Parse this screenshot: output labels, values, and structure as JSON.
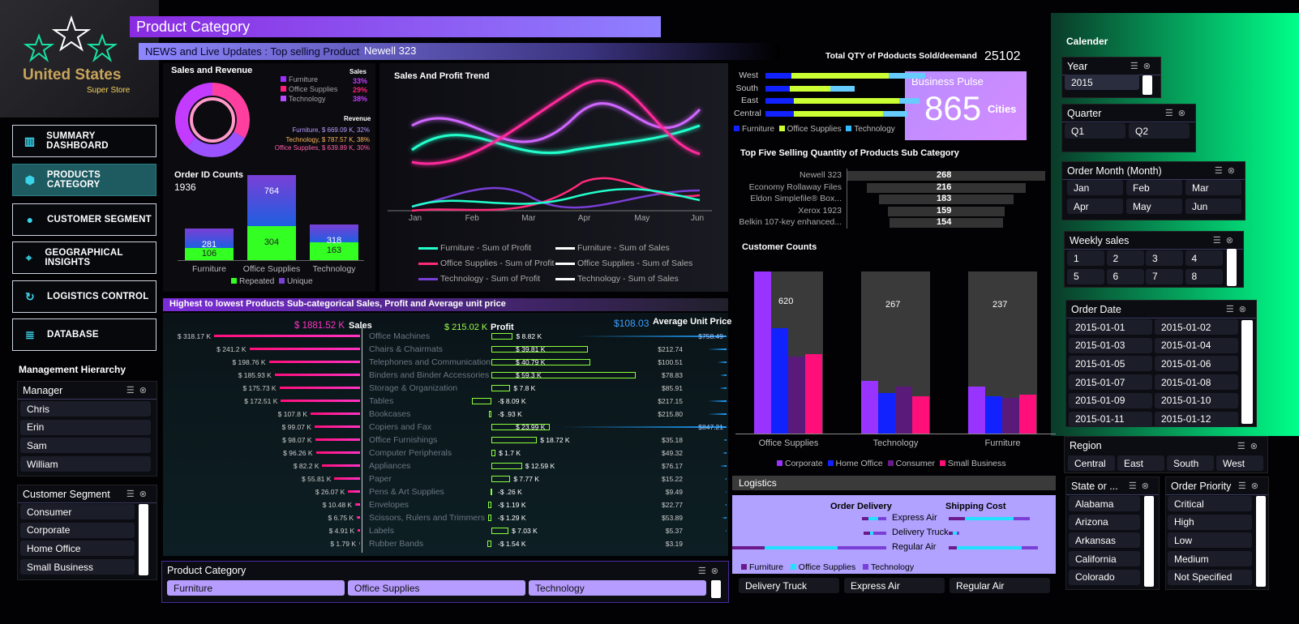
{
  "header": {
    "title": "Product Category",
    "news_label": "NEWS and Live Updates : Top selling Product",
    "news_value": "Newell 323"
  },
  "logo": {
    "line1": "United States",
    "line2": "Super Store"
  },
  "nav": [
    {
      "label": "SUMMARY DASHBOARD",
      "icon": "bar-chart-icon"
    },
    {
      "label": "PRODUCTS CATEGORY",
      "icon": "cube-icon"
    },
    {
      "label": "CUSTOMER SEGMENT",
      "icon": "user-icon"
    },
    {
      "label": "GEOGRAPHICAL INSIGHTS",
      "icon": "map-pin-icon"
    },
    {
      "label": "LOGISTICS CONTROL",
      "icon": "refresh-icon"
    },
    {
      "label": "DATABASE",
      "icon": "database-icon"
    }
  ],
  "management": {
    "title": "Management Hierarchy",
    "manager_title": "Manager",
    "managers": [
      "Chris",
      "Erin",
      "Sam",
      "William"
    ],
    "segment_title": "Customer Segment",
    "segments": [
      "Consumer",
      "Corporate",
      "Home Office",
      "Small Business"
    ]
  },
  "sales_revenue": {
    "title": "Sales and Revenue",
    "legend": [
      "Furniture",
      "Office Supplies",
      "Technology"
    ],
    "sales_label": "Sales",
    "sales_pct": [
      "33%",
      "29%",
      "38%"
    ],
    "revenue_label": "Revenue",
    "revenue": [
      "Furniture, $ 669.09 K, 32%",
      "Technology, $ 787.57 K, 38%",
      "Office Supplies, $ 639.89 K, 30%"
    ]
  },
  "orders": {
    "title": "Order ID Counts",
    "total": "1936",
    "categories": [
      "Furniture",
      "Office Supplies",
      "Technology"
    ],
    "totals": [
      "281",
      "764",
      "318"
    ],
    "repeated": [
      "106",
      "304",
      "163"
    ],
    "legend": [
      "Repeated",
      "Unique"
    ]
  },
  "trend": {
    "title": "Sales And Profit Trend",
    "months": [
      "Jan",
      "Feb",
      "Mar",
      "Apr",
      "May",
      "Jun"
    ],
    "legend": [
      "Furniture - Sum of Profit",
      "Furniture - Sum of Sales",
      "Office Supplies - Sum of Profit",
      "Office Supplies - Sum of Sales",
      "Technology - Sum of Profit",
      "Technology - Sum of Sales"
    ]
  },
  "qty": {
    "label": "Total QTY of Pdoducts Sold/deemand",
    "value": "25102"
  },
  "region_bars": {
    "regions": [
      "West",
      "South",
      "East",
      "Central"
    ],
    "legend": [
      "Furniture",
      "Office Supplies",
      "Technology"
    ]
  },
  "pulse": {
    "title": "Business Pulse",
    "value": "865",
    "unit": "Cities"
  },
  "top5": {
    "title": "Top Five Selling Quantity of Products Sub Category",
    "items": [
      {
        "name": "Newell 323",
        "value": "268"
      },
      {
        "name": "Economy Rollaway Files",
        "value": "216"
      },
      {
        "name": "Eldon Simplefile® Box...",
        "value": "183"
      },
      {
        "name": "Xerox 1923",
        "value": "159"
      },
      {
        "name": "Belkin 107-key enhanced...",
        "value": "154"
      }
    ]
  },
  "customer_counts": {
    "title": "Customer Counts",
    "categories": [
      "Office Supplies",
      "Technology",
      "Furniture"
    ],
    "totals": [
      "620",
      "267",
      "237"
    ],
    "legend": [
      "Corporate",
      "Home Office",
      "Consumer",
      "Small Business"
    ]
  },
  "subcat": {
    "title": "Highest  to  lowest Products Sub-categorical Sales, Profit and Average unit price",
    "sales_total": "$ 1881.52 K",
    "sales_label": "Sales",
    "profit_total": "$ 215.02 K",
    "profit_label": "Profit",
    "aup_total": "$108.03",
    "aup_label": "Average Unit Price",
    "rows": [
      {
        "name": "Office Machines",
        "sales": "$ 318.17 K",
        "profit": "$ 8.82 K",
        "aup": "$758.49"
      },
      {
        "name": "Chairs & Chairmats",
        "sales": "$ 241.2 K",
        "profit": "$ 39.81 K",
        "aup": "$212.74"
      },
      {
        "name": "Telephones and Communication",
        "sales": "$ 198.76 K",
        "profit": "$ 40.79 K",
        "aup": "$100.51"
      },
      {
        "name": "Binders and Binder Accessories",
        "sales": "$ 185.93 K",
        "profit": "$ 59.3 K",
        "aup": "$78.83"
      },
      {
        "name": "Storage & Organization",
        "sales": "$ 175.73 K",
        "profit": "$ 7.8 K",
        "aup": "$85.91"
      },
      {
        "name": "Tables",
        "sales": "$ 172.51 K",
        "profit": "-$ 8.09 K",
        "aup": "$217.15"
      },
      {
        "name": "Bookcases",
        "sales": "$ 107.8 K",
        "profit": "-$ .93 K",
        "aup": "$215.80"
      },
      {
        "name": "Copiers and Fax",
        "sales": "$ 99.07 K",
        "profit": "$ 23.99 K",
        "aup": "$847.21"
      },
      {
        "name": "Office Furnishings",
        "sales": "$ 98.07 K",
        "profit": "$ 18.72 K",
        "aup": "$35.18"
      },
      {
        "name": "Computer Peripherals",
        "sales": "$ 96.26 K",
        "profit": "$ 1.7 K",
        "aup": "$49.32"
      },
      {
        "name": "Appliances",
        "sales": "$ 82.2 K",
        "profit": "$ 12.59 K",
        "aup": "$76.17"
      },
      {
        "name": "Paper",
        "sales": "$ 55.81 K",
        "profit": "$ 7.77 K",
        "aup": "$15.22"
      },
      {
        "name": "Pens & Art Supplies",
        "sales": "$ 26.07 K",
        "profit": "-$ .26 K",
        "aup": "$9.49"
      },
      {
        "name": "Envelopes",
        "sales": "$ 10.48 K",
        "profit": "-$ 1.19 K",
        "aup": "$22.77"
      },
      {
        "name": "Scissors, Rulers and Trimmers",
        "sales": "$ 6.75 K",
        "profit": "-$ 1.29 K",
        "aup": "$53.89"
      },
      {
        "name": "Labels",
        "sales": "$ 4.91 K",
        "profit": "$ 7.03 K",
        "aup": "$5.37"
      },
      {
        "name": "Rubber Bands",
        "sales": "$ 1.79 K",
        "profit": "-$ 1.54 K",
        "aup": "$3.19"
      }
    ]
  },
  "product_category": {
    "title": "Product Category",
    "items": [
      "Furniture",
      "Office Supplies",
      "Technology"
    ]
  },
  "logistics": {
    "title": "Logistics",
    "delivery_title": "Order Delivery",
    "cost_title": "Shipping Cost",
    "modes": [
      "Express Air",
      "Delivery Truck",
      "Regular Air"
    ],
    "legend": [
      "Furniture",
      "Office Supplies",
      "Technology"
    ],
    "slicer": [
      "Delivery Truck",
      "Express Air",
      "Regular Air"
    ]
  },
  "calendar": {
    "title": "Calender",
    "year_title": "Year",
    "years": [
      "2015"
    ],
    "quarter_title": "Quarter",
    "quarters": [
      "Q1",
      "Q2"
    ],
    "month_title": "Order Month (Month)",
    "months": [
      "Jan",
      "Feb",
      "Mar",
      "Apr",
      "May",
      "Jun"
    ],
    "weekly_title": "Weekly sales",
    "weeks": [
      "1",
      "2",
      "3",
      "4",
      "5",
      "6",
      "7",
      "8"
    ],
    "date_title": "Order Date",
    "dates": [
      "2015-01-01",
      "2015-01-02",
      "2015-01-03",
      "2015-01-04",
      "2015-01-05",
      "2015-01-06",
      "2015-01-07",
      "2015-01-08",
      "2015-01-09",
      "2015-01-10",
      "2015-01-11",
      "2015-01-12"
    ]
  },
  "region": {
    "title": "Region",
    "items": [
      "Central",
      "East",
      "South",
      "West"
    ]
  },
  "state": {
    "title": "State or ...",
    "items": [
      "Alabama",
      "Arizona",
      "Arkansas",
      "California",
      "Colorado"
    ]
  },
  "priority": {
    "title": "Order Priority",
    "items": [
      "Critical",
      "High",
      "Low",
      "Medium",
      "Not Specified"
    ]
  },
  "colors": {
    "furniture": "#9b30ff",
    "office": "#ff1f7a",
    "technology": "#b44cff",
    "accent": "#7b61ff",
    "green": "#00ff85"
  }
}
